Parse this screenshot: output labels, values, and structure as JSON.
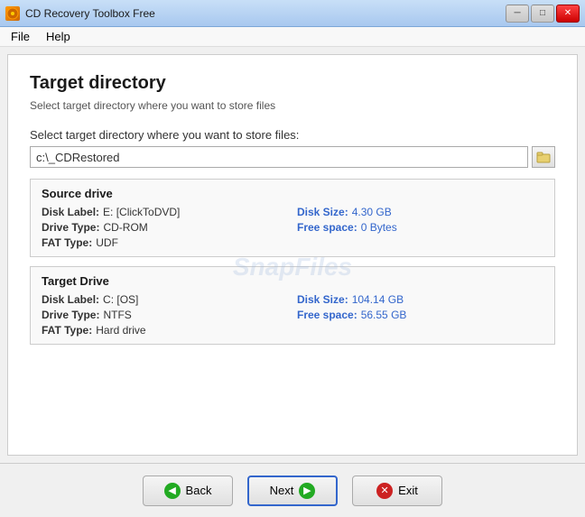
{
  "titlebar": {
    "title": "CD Recovery Toolbox Free",
    "icon": "CD",
    "minimize": "─",
    "maximize": "□",
    "close": "✕"
  },
  "menubar": {
    "items": [
      {
        "label": "File"
      },
      {
        "label": "Help"
      }
    ]
  },
  "page": {
    "title": "Target directory",
    "subtitle": "Select target directory where you want to store files",
    "field_label": "Select target directory where you want to store files:",
    "path_value": "c:\\_CDRestored"
  },
  "source_drive": {
    "panel_title": "Source drive",
    "disk_label_key": "Disk Label:",
    "disk_label_val": "E: [ClickToDVD]",
    "drive_type_key": "Drive Type:",
    "drive_type_val": "CD-ROM",
    "fat_type_key": "FAT Type:",
    "fat_type_val": "UDF",
    "disk_size_key": "Disk Size:",
    "disk_size_val": "4.30 GB",
    "free_space_key": "Free space:",
    "free_space_val": "0 Bytes"
  },
  "target_drive": {
    "panel_title": "Target Drive",
    "disk_label_key": "Disk Label:",
    "disk_label_val": "C: [OS]",
    "drive_type_key": "Drive Type:",
    "drive_type_val": "NTFS",
    "fat_type_key": "FAT Type:",
    "fat_type_val": "Hard drive",
    "disk_size_key": "Disk Size:",
    "disk_size_val": "104.14 GB",
    "free_space_key": "Free space:",
    "free_space_val": "56.55 GB"
  },
  "watermark": "SnapFiles",
  "footer": {
    "back_label": "Back",
    "next_label": "Next",
    "exit_label": "Exit"
  }
}
